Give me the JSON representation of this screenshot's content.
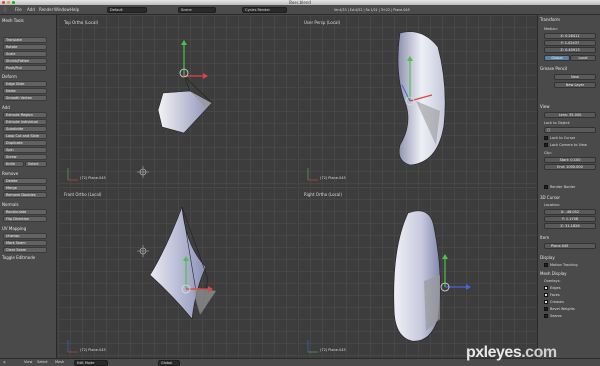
{
  "window": {
    "title": "Boss.blend"
  },
  "header": {
    "menus": [
      "File",
      "Add",
      "Render",
      "Window",
      "Help"
    ],
    "layout": "Default",
    "scene": "Scene",
    "engine": "Cycles Render",
    "stats": "Ve:4/33 | Ed:4/52 | Fa:1/21 | Tri:22 | Plane.045"
  },
  "toolshelf": {
    "title": "Mesh Tools",
    "transform": [
      "Translate",
      "Rotate",
      "Scale",
      "Shrink/Fatten",
      "Push/Pull"
    ],
    "deform_title": "Deform",
    "deform": [
      "Edge Slide",
      "Noise",
      "Smooth Vertex"
    ],
    "add_title": "Add",
    "add": [
      "Extrude Region",
      "Extrude Individual",
      "Subdivide",
      "Loop Cut and Slide",
      "Duplicate",
      "Spin",
      "Screw"
    ],
    "knife": "Knife",
    "select": "Select",
    "remove_title": "Remove",
    "remove": [
      "Delete",
      "Merge",
      "Remove Doubles"
    ],
    "normals_title": "Normals",
    "normals": [
      "Recalculate",
      "Flip Direction"
    ],
    "uv_title": "UV Mapping",
    "uv": [
      "Unwrap",
      "Mark Seam",
      "Clear Seam"
    ],
    "toggle_title": "Toggle Editmode"
  },
  "viewports": {
    "top_left": {
      "label": "Top Ortho (Local)",
      "object": "(72) Plane.045"
    },
    "top_right": {
      "label": "User Persp (Local)",
      "object": "(72) Plane.045"
    },
    "bottom_left": {
      "label": "Front Ortho (Local)",
      "object": "(72) Plane.045"
    },
    "bottom_right": {
      "label": "Right Ortho (Local)",
      "object": "(72) Plane.045"
    }
  },
  "npanel": {
    "transform_title": "Transform",
    "median_label": "Median:",
    "x": "X: 0.28411",
    "y": "Y: 1.02437",
    "z": "Z: 0.40913",
    "global": "Global",
    "local": "Local",
    "grease_title": "Grease Pencil",
    "new": "New",
    "new_layer": "New Layer",
    "view_title": "View",
    "lens": "Lens: 35.000",
    "lock_object": "Lock to Object:",
    "lock_cursor": "Lock to Cursor",
    "lock_camera": "Lock Camera to View",
    "clip_label": "Clip:",
    "clip_start": "Start: 0.100",
    "clip_end": "End: 1000.000",
    "render_border": "Render Border",
    "cursor_title": "3D Cursor",
    "location_label": "Location:",
    "cx": "X: -46.052",
    "cy": "Y: 1.1708",
    "cz": "Z: 31.1826",
    "item_title": "Item",
    "item_name": "Plane.045",
    "display_title": "Display",
    "motion_tracking": "Motion Tracking",
    "mesh_display_title": "Mesh Display",
    "overlays_label": "Overlays:",
    "overlays": [
      "Edges",
      "Faces",
      "Creases",
      "Bevel Weights",
      "Seams"
    ]
  },
  "bottombar": {
    "items": [
      "View",
      "Select",
      "Mesh"
    ],
    "mode": "Edit Mode",
    "pivot": "Global"
  },
  "watermark": {
    "text": "pxleyes",
    "tld": ".com"
  }
}
